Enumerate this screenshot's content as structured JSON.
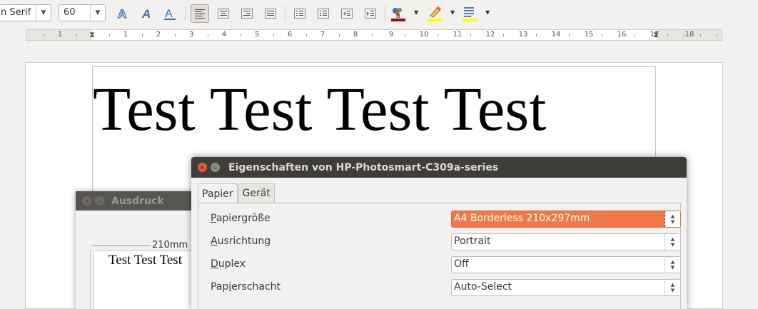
{
  "toolbar": {
    "font_name": "n Serif",
    "font_size": "60"
  },
  "ruler": {
    "numbers": [
      "1",
      "1",
      "2",
      "3",
      "4",
      "5",
      "6",
      "7",
      "8",
      "9",
      "10",
      "11",
      "12",
      "13",
      "14",
      "15",
      "16",
      "17",
      "18"
    ]
  },
  "document": {
    "text": "Test Test Test Test"
  },
  "print_dialog": {
    "title": "Ausdruck",
    "preview_width_label": "210mm",
    "preview_text": "Test Test Test"
  },
  "properties_dialog": {
    "title": "Eigenschaften von HP-Photosmart-C309a-series",
    "tabs": [
      "Papier",
      "Gerät"
    ],
    "rows": [
      {
        "mnemonic": "P",
        "rest": "apiergröße",
        "value": "A4 Borderless 210x297mm"
      },
      {
        "mnemonic": "A",
        "rest": "usrichtung",
        "value": "Portrait"
      },
      {
        "mnemonic": "D",
        "rest": "uplex",
        "value": "Off"
      },
      {
        "pre": "Pap",
        "mnemonic": "i",
        "rest": "erschacht",
        "value": "Auto-Select"
      }
    ]
  },
  "colors": {
    "selection": "#f07746",
    "titlebar_active": "#3f3d39",
    "close_button": "#e25c38"
  }
}
